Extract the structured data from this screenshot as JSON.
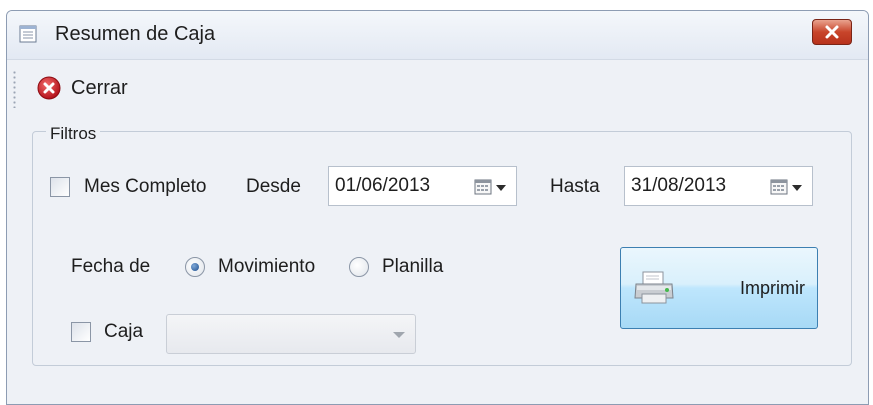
{
  "window": {
    "title": "Resumen de Caja"
  },
  "toolbar": {
    "close_label": "Cerrar"
  },
  "filters": {
    "legend": "Filtros",
    "mes_completo_label": "Mes Completo",
    "mes_completo_checked": false,
    "desde_label": "Desde",
    "desde_value": "01/06/2013",
    "hasta_label": "Hasta",
    "hasta_value": "31/08/2013",
    "fecha_de_label": "Fecha de",
    "fecha_options": [
      {
        "label": "Movimiento",
        "checked": true
      },
      {
        "label": "Planilla",
        "checked": false
      }
    ],
    "caja_label": "Caja",
    "caja_checked": false,
    "caja_value": ""
  },
  "actions": {
    "print_label": "Imprimir"
  },
  "icons": {
    "title": "form-icon",
    "close_window": "close-x-icon",
    "cerrar": "red-x-circle-icon",
    "calendar": "calendar-dropdown-icon",
    "print": "printer-icon"
  },
  "colors": {
    "window_bg": "#eef1f6",
    "close_button": "#c8452b",
    "print_button": "#bee6fd",
    "radio_selected": "#1f4f8f"
  }
}
